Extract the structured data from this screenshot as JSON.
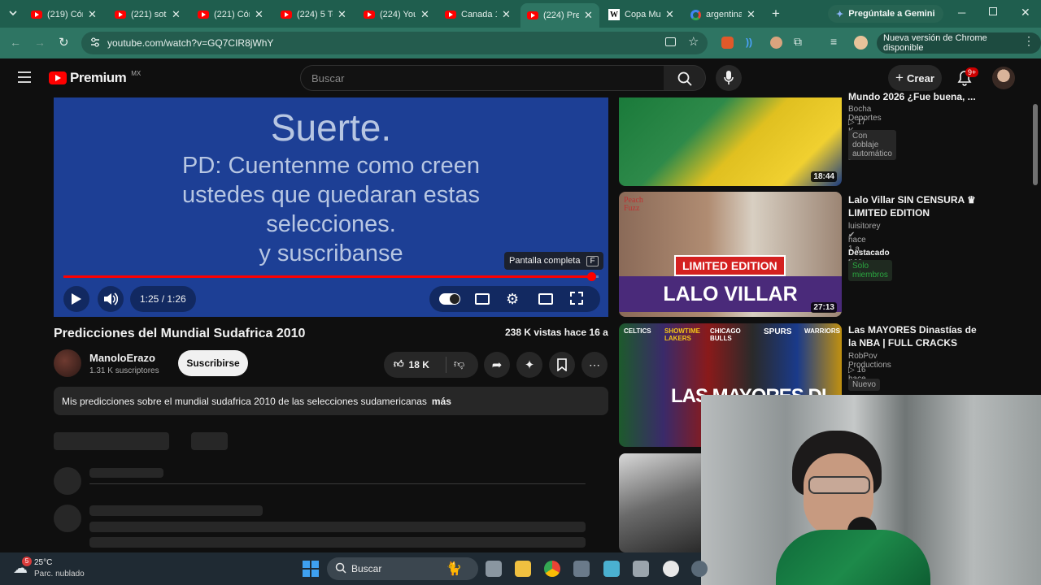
{
  "browser": {
    "tabs": [
      {
        "title": "(219) Cón",
        "active": false
      },
      {
        "title": "(221) sot",
        "active": false
      },
      {
        "title": "(221) Cón",
        "active": false
      },
      {
        "title": "(224) 5 Te",
        "active": false
      },
      {
        "title": "(224) You",
        "active": false
      },
      {
        "title": "Canada 1",
        "active": false
      },
      {
        "title": "(224) Pre",
        "active": true
      },
      {
        "title": "Copa Mu",
        "active": false
      },
      {
        "title": "argentina",
        "active": false
      }
    ],
    "gemini_label": "Pregúntale a Gemini",
    "url": "youtube.com/watch?v=GQ7CIR8jWhY",
    "update_label": "Nueva versión de Chrome disponible"
  },
  "youtube": {
    "logo_text": "Premium",
    "logo_region": "MX",
    "search_placeholder": "Buscar",
    "create_label": "Crear",
    "notif_count": "9+"
  },
  "player": {
    "slide_title": "Suerte.",
    "slide_lines": [
      "PD: Cuentenme como creen",
      "ustedes que quedaran estas",
      "selecciones.",
      "y suscribanse"
    ],
    "fullscreen_tip": "Pantalla completa",
    "fullscreen_key": "F",
    "time": "1:25 / 1:26",
    "progress": 0.987
  },
  "video": {
    "title": "Predicciones del Mundial Sudafrica 2010",
    "stats": "238 K vistas  hace 16 a",
    "channel": "ManoloErazo",
    "subscribers": "1.31 K suscriptores",
    "subscribe_label": "Suscribirse",
    "likes": "18 K",
    "description": "Mis predicciones sobre el mundial sudafrica 2010 de las selecciones sudamericanas",
    "more_label": "más"
  },
  "recommendations": [
    {
      "title": "Mundo 2026 ¿Fue buena, ...",
      "channel": "Bocha Deportes",
      "meta": "▷ 17 K  hace 2 sem.",
      "badge": "Con doblaje automático",
      "duration": "18:44"
    },
    {
      "title": "Lalo Villar SIN CENSURA ♛ LIMITED EDITION",
      "channel": "luisitorey",
      "meta": "hace 1 a",
      "featured": "Destacado por YouTube",
      "badge": "Solo miembros",
      "duration": "27:13",
      "thumb_text_1": "LIMITED EDITION",
      "thumb_text_2": "LALO VILLAR",
      "thumb_brand": "Peach Fuzz"
    },
    {
      "title": "Las MAYORES Dinastías de la NBA | FULL CRACKS",
      "channel": "RobPov Productions",
      "meta": "▷ 16  hace 10 h",
      "badge": "Nuevo",
      "thumb_text": "LAS MAYORES DI",
      "teams": [
        "CELTICS",
        "SHOWTIME LAKERS",
        "CHICAGO BULLS",
        "SPURS",
        "WARRIORS"
      ]
    }
  ],
  "taskbar": {
    "temperature": "25°C",
    "weather": "Parc. nublado",
    "weather_badge": "5",
    "search_label": "Buscar"
  },
  "colors": {
    "accent_red": "#ff0000",
    "player_bg": "#1d3f95",
    "chrome_green": "#2e7563"
  }
}
